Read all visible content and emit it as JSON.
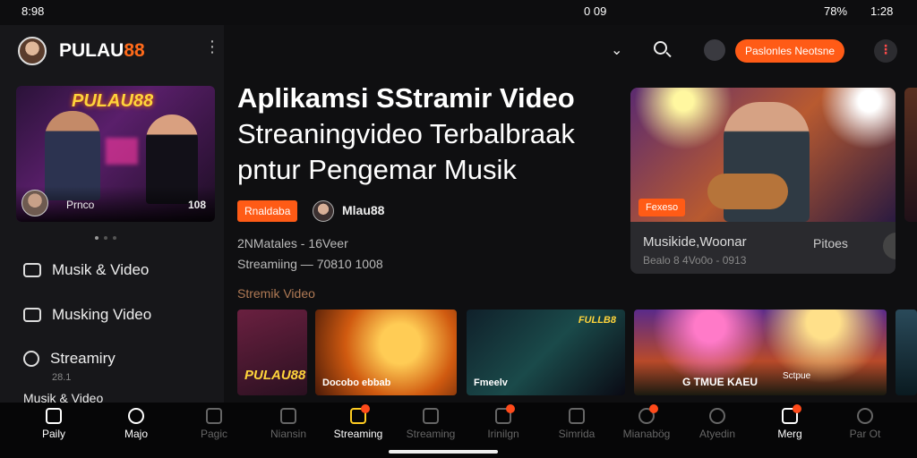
{
  "status_bar": {
    "left_time": "8:98",
    "center": "0 09",
    "battery": "78%",
    "time": "1:28"
  },
  "sidebar": {
    "brand_part1": "PULAU",
    "brand_part2": "88",
    "card": {
      "logo": "PULAU88",
      "author": "Prnco",
      "count": "108"
    },
    "items": [
      {
        "label": "Musik & Video",
        "icon": "music-video-icon"
      },
      {
        "label": "Musking Video",
        "icon": "video-icon"
      },
      {
        "label": "Streamiry",
        "sub": "28.1",
        "icon": "stream-icon"
      },
      {
        "label": "Musik & Video",
        "icon": "music-icon"
      }
    ]
  },
  "topbar": {
    "pill_label": "Paslonles Neotsne"
  },
  "hero": {
    "title_line1": "Aplikamsi SStramir Video",
    "title_line2": "Streaningvideo Terbalbraak",
    "title_line3": "pntur Pengemar Musik",
    "tag": "Rnaldaba",
    "author": "Mlau88",
    "stat1": "2NMatales - 16Veer",
    "stat2": "Streamiing  — 70810 1008"
  },
  "feature": {
    "tag": "Fexeso",
    "title": "Musikide,Woonar",
    "subtitle": "Bealo 8 4Vo0o   -   0913",
    "button": "Pitoes"
  },
  "section_title": "Stremik Video",
  "thumbnails": [
    {
      "caption": "PULAU88"
    },
    {
      "caption": "Docobo ebbab"
    },
    {
      "caption": "Fmeelv",
      "badge": "FULLB8"
    },
    {
      "caption": "G TMUE KAEU",
      "caption2": "Sctpue"
    },
    {
      "caption": ""
    }
  ],
  "nav": [
    {
      "label": "Paily",
      "icon": "home-icon",
      "state": "on"
    },
    {
      "label": "Majo",
      "icon": "clock-icon",
      "state": "on"
    },
    {
      "label": "Pagic",
      "icon": "triangle-icon",
      "state": ""
    },
    {
      "label": "Niansin",
      "icon": "tag-icon",
      "state": ""
    },
    {
      "label": "Streaming",
      "icon": "streaming-icon",
      "state": "hl",
      "badge": true
    },
    {
      "label": "Streaming",
      "icon": "calendar-icon",
      "state": ""
    },
    {
      "label": "Irinilgn",
      "icon": "chat-icon",
      "state": "",
      "badge": true
    },
    {
      "label": "Simrida",
      "icon": "edit-icon",
      "state": ""
    },
    {
      "label": "Mianabög",
      "icon": "record-icon",
      "state": "",
      "badge": true
    },
    {
      "label": "Atyedin",
      "icon": "settings-icon",
      "state": ""
    },
    {
      "label": "Merg",
      "icon": "bookmark-icon",
      "state": "on",
      "badge": true
    },
    {
      "label": "Par Ot",
      "icon": "search-icon",
      "state": ""
    }
  ]
}
